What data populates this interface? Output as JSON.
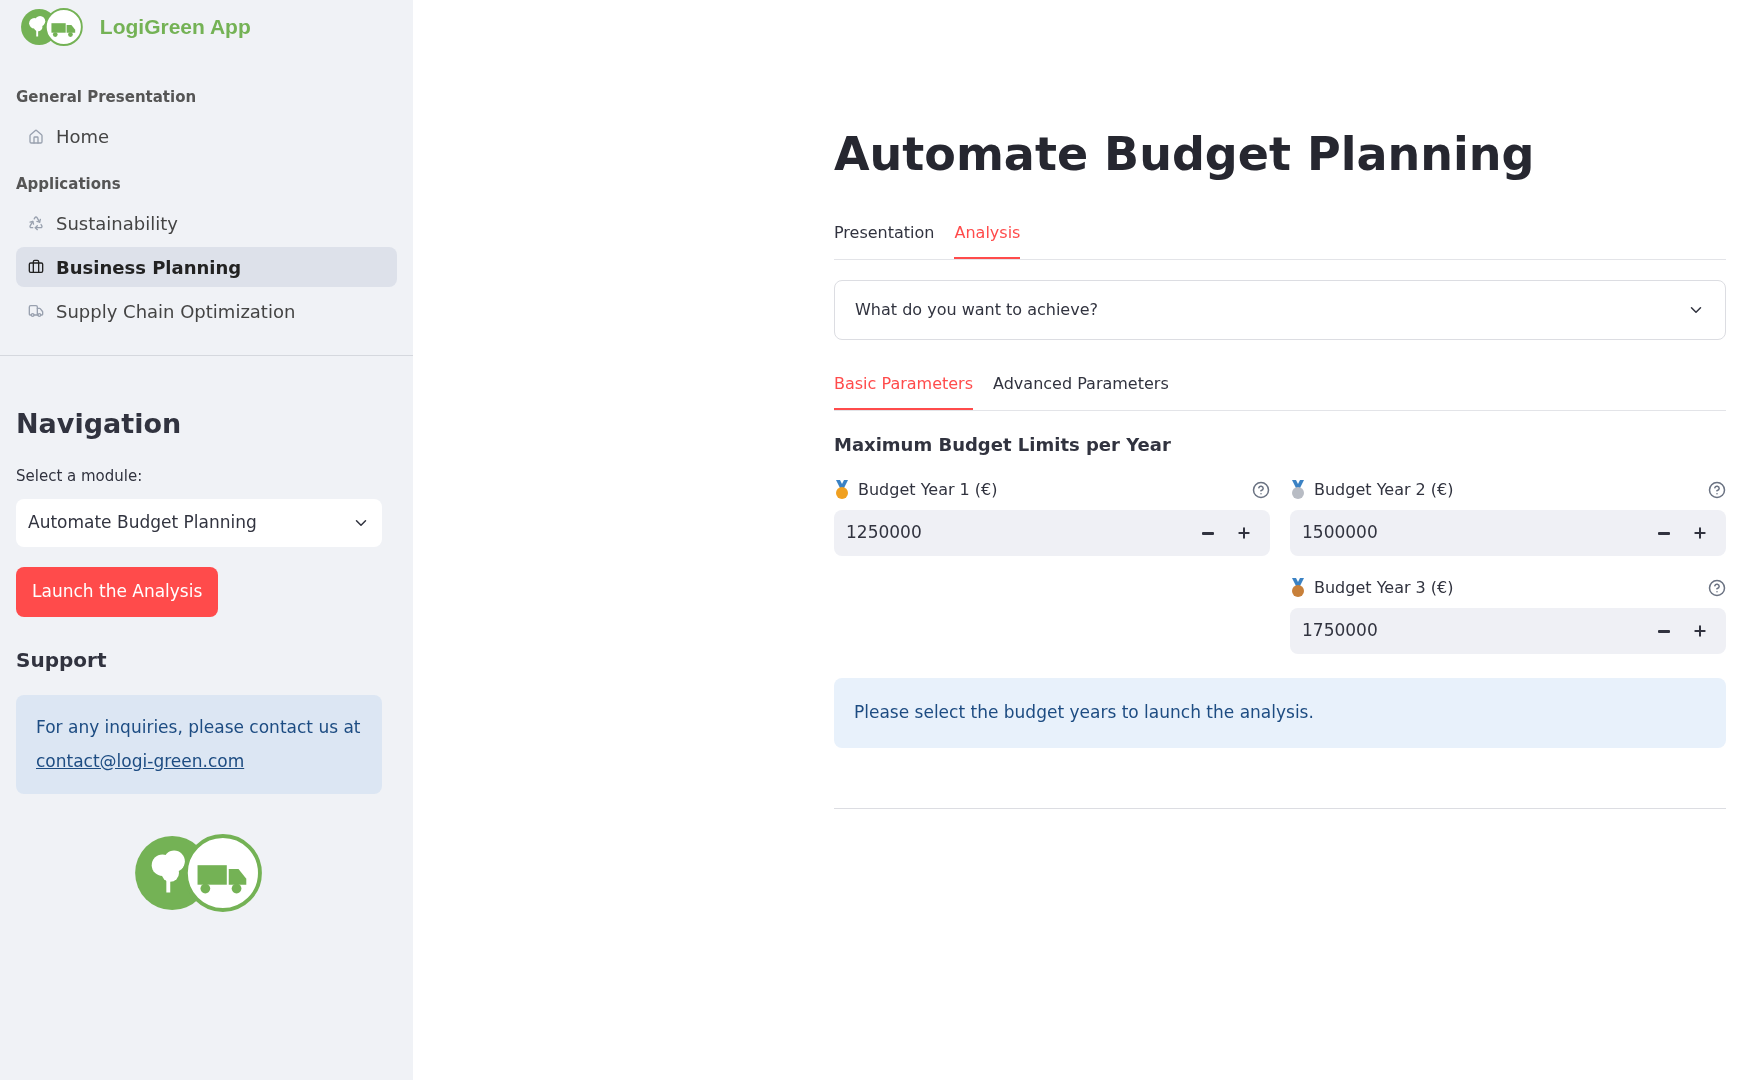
{
  "sidebar": {
    "app_name": "LogiGreen App",
    "sections": [
      {
        "title": "General Presentation",
        "items": [
          {
            "label": "Home",
            "selected": false
          }
        ]
      },
      {
        "title": "Applications",
        "items": [
          {
            "label": "Sustainability",
            "selected": false
          },
          {
            "label": "Business Planning",
            "selected": true
          },
          {
            "label": "Supply Chain Optimization",
            "selected": false
          }
        ]
      }
    ],
    "navigation": {
      "title": "Navigation",
      "select_label": "Select a module:",
      "select_value": "Automate Budget Planning",
      "button": "Launch the Analysis"
    },
    "support": {
      "title": "Support",
      "text": "For any inquiries, please contact us at",
      "email": "contact@logi-green.com"
    }
  },
  "main": {
    "title": "Automate Budget Planning",
    "tabs": [
      {
        "label": "Presentation",
        "selected": false
      },
      {
        "label": "Analysis",
        "selected": true
      }
    ],
    "expander": {
      "label": "What do you want to achieve?",
      "expanded": false
    },
    "subtabs": [
      {
        "label": "Basic Parameters",
        "selected": true
      },
      {
        "label": "Advanced Parameters",
        "selected": false
      }
    ],
    "subheading": "Maximum Budget Limits per Year",
    "fields": [
      {
        "label": "Budget Year 1 (€)",
        "value": "1250000",
        "color": "#f0a020"
      },
      {
        "label": "Budget Year 2 (€)",
        "value": "1500000",
        "color": "#b8bcc4"
      },
      {
        "label": "Budget Year 3 (€)",
        "value": "1750000",
        "color": "#c8803a"
      }
    ],
    "info": "Please select the budget years to launch the analysis."
  }
}
